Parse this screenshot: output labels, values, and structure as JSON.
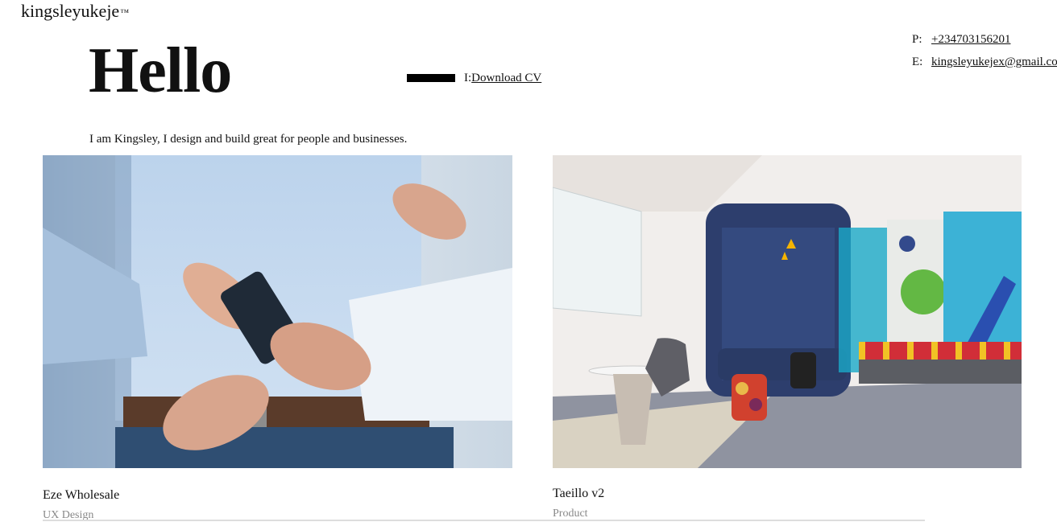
{
  "header": {
    "logo": "kingsleyukeje",
    "logo_mark": "™"
  },
  "hero": {
    "title": "Hello",
    "download_prefix": "I:",
    "download_label": "Download CV",
    "intro": "I am Kingsley, I design and build great for people and businesses."
  },
  "contact": {
    "phone_key": "P:",
    "phone": "+234703156201",
    "email_key": "E:",
    "email": "kingsleyukejex@gmail.co"
  },
  "projects": [
    {
      "title": "Eze Wholesale",
      "category": "UX Design",
      "image": "person-holding-phone-photo"
    },
    {
      "title": "Taeillo v2",
      "category": "Product",
      "image": "office-lounge-photo"
    }
  ],
  "colors": {
    "text": "#111111",
    "muted": "#888888",
    "background": "#ffffff"
  }
}
